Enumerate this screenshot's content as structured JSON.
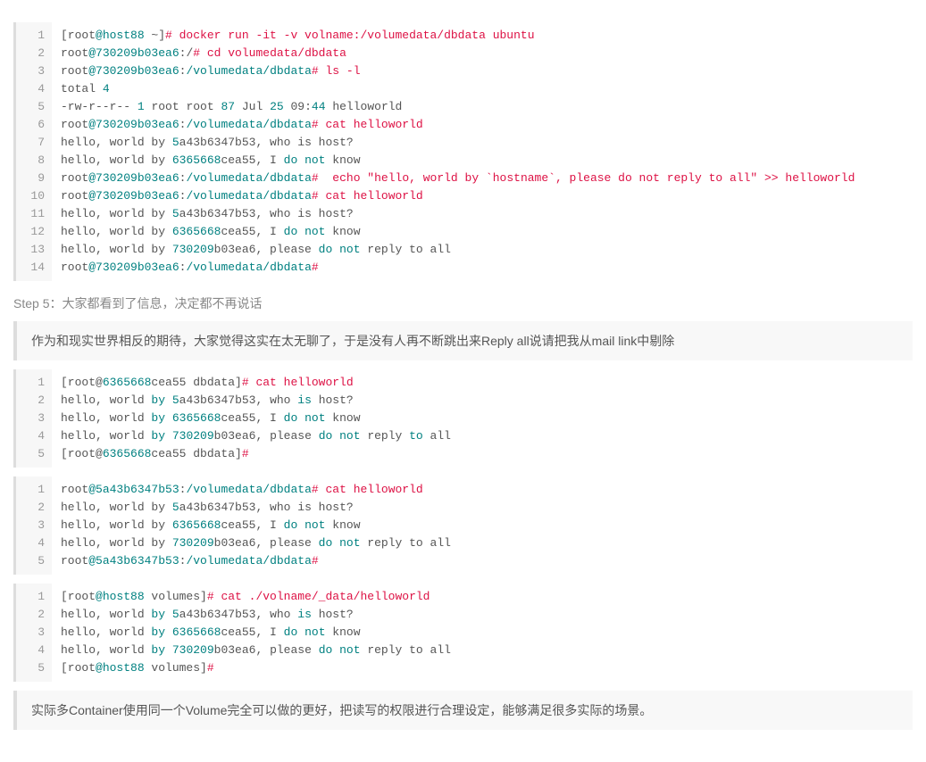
{
  "block1": {
    "lines": [
      [
        {
          "t": "[root",
          "c": "default"
        },
        {
          "t": "@host88",
          "c": "teal"
        },
        {
          "t": " ~]",
          "c": "default"
        },
        {
          "t": "# docker run -it -v volname:/volumedata/dbdata ubuntu",
          "c": "orange"
        }
      ],
      [
        {
          "t": "root",
          "c": "default"
        },
        {
          "t": "@730209b03ea6",
          "c": "teal"
        },
        {
          "t": ":/",
          "c": "default"
        },
        {
          "t": "# cd volumedata/dbdata",
          "c": "orange"
        }
      ],
      [
        {
          "t": "root",
          "c": "default"
        },
        {
          "t": "@730209b03ea6",
          "c": "teal"
        },
        {
          "t": ":",
          "c": "default"
        },
        {
          "t": "/volumedata/dbdata",
          "c": "teal"
        },
        {
          "t": "# ls -l",
          "c": "orange"
        }
      ],
      [
        {
          "t": "total ",
          "c": "default"
        },
        {
          "t": "4",
          "c": "num"
        }
      ],
      [
        {
          "t": "-rw-r--r-- ",
          "c": "default"
        },
        {
          "t": "1",
          "c": "num"
        },
        {
          "t": " root root ",
          "c": "default"
        },
        {
          "t": "87",
          "c": "num"
        },
        {
          "t": " Jul ",
          "c": "default"
        },
        {
          "t": "25",
          "c": "num"
        },
        {
          "t": " 09:",
          "c": "default"
        },
        {
          "t": "44",
          "c": "num"
        },
        {
          "t": " helloworld",
          "c": "default"
        }
      ],
      [
        {
          "t": "root",
          "c": "default"
        },
        {
          "t": "@730209b03ea6",
          "c": "teal"
        },
        {
          "t": ":",
          "c": "default"
        },
        {
          "t": "/volumedata/dbdata",
          "c": "teal"
        },
        {
          "t": "# cat helloworld",
          "c": "orange"
        }
      ],
      [
        {
          "t": "hello, world by ",
          "c": "default"
        },
        {
          "t": "5",
          "c": "num"
        },
        {
          "t": "a43b6347b53, who is host?",
          "c": "default"
        }
      ],
      [
        {
          "t": "hello, world by ",
          "c": "default"
        },
        {
          "t": "6365668",
          "c": "num"
        },
        {
          "t": "cea55, I ",
          "c": "default"
        },
        {
          "t": "do",
          "c": "teal"
        },
        {
          "t": " ",
          "c": "default"
        },
        {
          "t": "not",
          "c": "teal"
        },
        {
          "t": " know",
          "c": "default"
        }
      ],
      [
        {
          "t": "root",
          "c": "default"
        },
        {
          "t": "@730209b03ea6",
          "c": "teal"
        },
        {
          "t": ":",
          "c": "default"
        },
        {
          "t": "/volumedata/dbdata",
          "c": "teal"
        },
        {
          "t": "#",
          "c": "orange"
        },
        {
          "t": "  echo \"hello, world by `hostname`, please do not reply to all\" >> helloworld",
          "c": "orange"
        }
      ],
      [
        {
          "t": "root",
          "c": "default"
        },
        {
          "t": "@730209b03ea6",
          "c": "teal"
        },
        {
          "t": ":",
          "c": "default"
        },
        {
          "t": "/volumedata/dbdata",
          "c": "teal"
        },
        {
          "t": "# cat helloworld",
          "c": "orange"
        }
      ],
      [
        {
          "t": "hello, world by ",
          "c": "default"
        },
        {
          "t": "5",
          "c": "num"
        },
        {
          "t": "a43b6347b53, who is host?",
          "c": "default"
        }
      ],
      [
        {
          "t": "hello, world by ",
          "c": "default"
        },
        {
          "t": "6365668",
          "c": "num"
        },
        {
          "t": "cea55, I ",
          "c": "default"
        },
        {
          "t": "do",
          "c": "teal"
        },
        {
          "t": " ",
          "c": "default"
        },
        {
          "t": "not",
          "c": "teal"
        },
        {
          "t": " know",
          "c": "default"
        }
      ],
      [
        {
          "t": "hello, world by ",
          "c": "default"
        },
        {
          "t": "730209",
          "c": "num"
        },
        {
          "t": "b03ea6, please ",
          "c": "default"
        },
        {
          "t": "do",
          "c": "teal"
        },
        {
          "t": " ",
          "c": "default"
        },
        {
          "t": "not",
          "c": "teal"
        },
        {
          "t": " reply to all",
          "c": "default"
        }
      ],
      [
        {
          "t": "root",
          "c": "default"
        },
        {
          "t": "@730209b03ea6",
          "c": "teal"
        },
        {
          "t": ":",
          "c": "default"
        },
        {
          "t": "/volumedata/dbdata",
          "c": "teal"
        },
        {
          "t": "#",
          "c": "orange"
        }
      ]
    ]
  },
  "step5_title": "Step 5：大家都看到了信息，决定都不再说话",
  "quote1": "作为和现实世界相反的期待，大家觉得这实在太无聊了，于是没有人再不断跳出来Reply all说请把我从mail link中剔除",
  "block2": {
    "lines": [
      [
        {
          "t": "[root@",
          "c": "default"
        },
        {
          "t": "6365668",
          "c": "num"
        },
        {
          "t": "cea55 dbdata]",
          "c": "default"
        },
        {
          "t": "# cat helloworld",
          "c": "orange"
        }
      ],
      [
        {
          "t": "hello, world ",
          "c": "default"
        },
        {
          "t": "by",
          "c": "teal"
        },
        {
          "t": " ",
          "c": "default"
        },
        {
          "t": "5",
          "c": "num"
        },
        {
          "t": "a43b6347b53, who ",
          "c": "default"
        },
        {
          "t": "is",
          "c": "teal"
        },
        {
          "t": " host?",
          "c": "default"
        }
      ],
      [
        {
          "t": "hello, world ",
          "c": "default"
        },
        {
          "t": "by",
          "c": "teal"
        },
        {
          "t": " ",
          "c": "default"
        },
        {
          "t": "6365668",
          "c": "num"
        },
        {
          "t": "cea55, I ",
          "c": "default"
        },
        {
          "t": "do",
          "c": "teal"
        },
        {
          "t": " ",
          "c": "default"
        },
        {
          "t": "not",
          "c": "teal"
        },
        {
          "t": " know",
          "c": "default"
        }
      ],
      [
        {
          "t": "hello, world ",
          "c": "default"
        },
        {
          "t": "by",
          "c": "teal"
        },
        {
          "t": " ",
          "c": "default"
        },
        {
          "t": "730209",
          "c": "num"
        },
        {
          "t": "b03ea6, please ",
          "c": "default"
        },
        {
          "t": "do",
          "c": "teal"
        },
        {
          "t": " ",
          "c": "default"
        },
        {
          "t": "not",
          "c": "teal"
        },
        {
          "t": " reply ",
          "c": "default"
        },
        {
          "t": "to",
          "c": "teal"
        },
        {
          "t": " all",
          "c": "default"
        }
      ],
      [
        {
          "t": "[root@",
          "c": "default"
        },
        {
          "t": "6365668",
          "c": "num"
        },
        {
          "t": "cea55 dbdata]",
          "c": "default"
        },
        {
          "t": "#",
          "c": "orange"
        }
      ]
    ]
  },
  "block3": {
    "lines": [
      [
        {
          "t": "root",
          "c": "default"
        },
        {
          "t": "@5a43b6347b53",
          "c": "teal"
        },
        {
          "t": ":",
          "c": "default"
        },
        {
          "t": "/volumedata/dbdata",
          "c": "teal"
        },
        {
          "t": "# cat helloworld",
          "c": "orange"
        }
      ],
      [
        {
          "t": "hello, world by ",
          "c": "default"
        },
        {
          "t": "5",
          "c": "num"
        },
        {
          "t": "a43b6347b53, who is host?",
          "c": "default"
        }
      ],
      [
        {
          "t": "hello, world by ",
          "c": "default"
        },
        {
          "t": "6365668",
          "c": "num"
        },
        {
          "t": "cea55, I ",
          "c": "default"
        },
        {
          "t": "do",
          "c": "teal"
        },
        {
          "t": " ",
          "c": "default"
        },
        {
          "t": "not",
          "c": "teal"
        },
        {
          "t": " know",
          "c": "default"
        }
      ],
      [
        {
          "t": "hello, world by ",
          "c": "default"
        },
        {
          "t": "730209",
          "c": "num"
        },
        {
          "t": "b03ea6, please ",
          "c": "default"
        },
        {
          "t": "do",
          "c": "teal"
        },
        {
          "t": " ",
          "c": "default"
        },
        {
          "t": "not",
          "c": "teal"
        },
        {
          "t": " reply to all",
          "c": "default"
        }
      ],
      [
        {
          "t": "root",
          "c": "default"
        },
        {
          "t": "@5a43b6347b53",
          "c": "teal"
        },
        {
          "t": ":",
          "c": "default"
        },
        {
          "t": "/volumedata/dbdata",
          "c": "teal"
        },
        {
          "t": "#",
          "c": "orange"
        }
      ]
    ]
  },
  "block4": {
    "lines": [
      [
        {
          "t": "[root",
          "c": "default"
        },
        {
          "t": "@host88",
          "c": "teal"
        },
        {
          "t": " volumes]",
          "c": "default"
        },
        {
          "t": "# cat ./volname/_data/helloworld",
          "c": "orange"
        }
      ],
      [
        {
          "t": "hello, world ",
          "c": "default"
        },
        {
          "t": "by",
          "c": "teal"
        },
        {
          "t": " ",
          "c": "default"
        },
        {
          "t": "5",
          "c": "num"
        },
        {
          "t": "a43b6347b53, who ",
          "c": "default"
        },
        {
          "t": "is",
          "c": "teal"
        },
        {
          "t": " host?",
          "c": "default"
        }
      ],
      [
        {
          "t": "hello, world ",
          "c": "default"
        },
        {
          "t": "by",
          "c": "teal"
        },
        {
          "t": " ",
          "c": "default"
        },
        {
          "t": "6365668",
          "c": "num"
        },
        {
          "t": "cea55, I ",
          "c": "default"
        },
        {
          "t": "do",
          "c": "teal"
        },
        {
          "t": " ",
          "c": "default"
        },
        {
          "t": "not",
          "c": "teal"
        },
        {
          "t": " know",
          "c": "default"
        }
      ],
      [
        {
          "t": "hello, world ",
          "c": "default"
        },
        {
          "t": "by",
          "c": "teal"
        },
        {
          "t": " ",
          "c": "default"
        },
        {
          "t": "730209",
          "c": "num"
        },
        {
          "t": "b03ea6, please ",
          "c": "default"
        },
        {
          "t": "do",
          "c": "teal"
        },
        {
          "t": " ",
          "c": "default"
        },
        {
          "t": "not",
          "c": "teal"
        },
        {
          "t": " reply to all",
          "c": "default"
        }
      ],
      [
        {
          "t": "[root",
          "c": "default"
        },
        {
          "t": "@host88",
          "c": "teal"
        },
        {
          "t": " volumes]",
          "c": "default"
        },
        {
          "t": "#",
          "c": "orange"
        }
      ]
    ]
  },
  "quote2": "实际多Container使用同一个Volume完全可以做的更好，把读写的权限进行合理设定，能够满足很多实际的场景。"
}
